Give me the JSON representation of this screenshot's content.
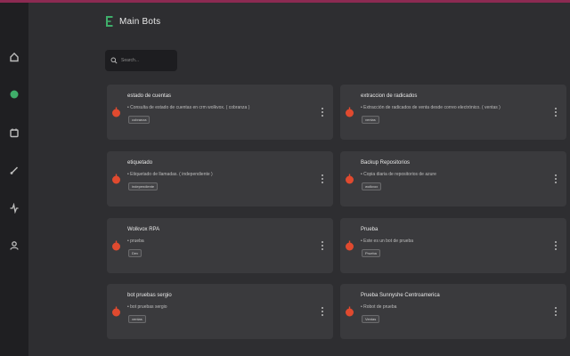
{
  "header": {
    "title": "Main Bots"
  },
  "search": {
    "placeholder": "Search..."
  },
  "sidebar": {
    "icons": [
      "home-icon",
      "robot-icon",
      "calendar-icon",
      "brush-icon",
      "activity-icon",
      "user-icon"
    ]
  },
  "colors": {
    "accent": "#8c2a52",
    "bot_icon": "#e04a2f",
    "logo": "#3fae6a"
  },
  "cards": [
    {
      "name": "estado de cuentas",
      "description": "• Consulta de estado de cuentas en crm wolkvox. ( cobranza )",
      "tag": "cobranza"
    },
    {
      "name": "extraccion de radicados",
      "description": "• Extracción de radicados de venta desde correo electrónico. ( ventas )",
      "tag": "ventas"
    },
    {
      "name": "etiquetado",
      "description": "• Etiquetado de llamadas. ( independiente )",
      "tag": "independiente"
    },
    {
      "name": "Backup Repositorios",
      "description": "• Copia diaria de repositorios de azure",
      "tag": "wolkvox"
    },
    {
      "name": "Wolkvox RPA",
      "description": "• prueba",
      "tag": "Dev"
    },
    {
      "name": "Prueba",
      "description": "• Este es un bot de prueba",
      "tag": "Prueba"
    },
    {
      "name": "bot pruebas sergio",
      "description": "• bot pruebas sergio",
      "tag": "ventas"
    },
    {
      "name": "Prueba Sunnyshe Centroamerica",
      "description": "• Robot de prueba",
      "tag": "Ventas"
    }
  ]
}
